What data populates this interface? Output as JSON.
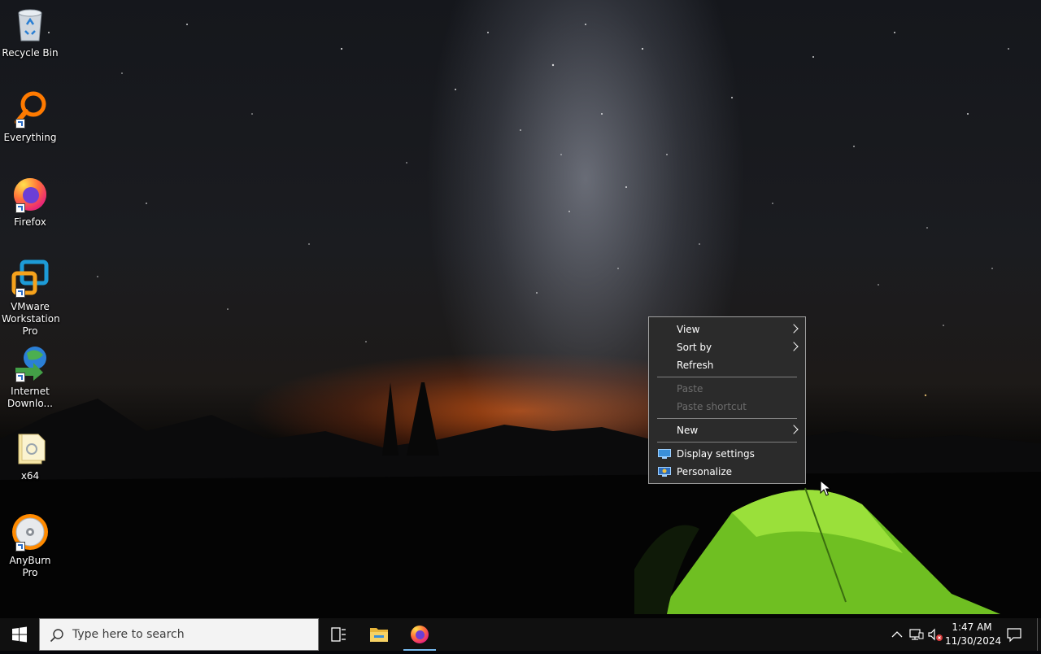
{
  "desktop_icons": [
    {
      "label": "Recycle Bin",
      "icon": "recycle-bin-icon"
    },
    {
      "label": "Everything",
      "icon": "everything-search-icon"
    },
    {
      "label": "Firefox",
      "icon": "firefox-icon"
    },
    {
      "label": "VMware Workstation Pro",
      "icon": "vmware-icon"
    },
    {
      "label": "Internet Downlo...",
      "icon": "internet-download-manager-icon"
    },
    {
      "label": "x64",
      "icon": "folder-icon"
    },
    {
      "label": "AnyBurn Pro",
      "icon": "anyburn-disc-icon"
    }
  ],
  "context_menu": {
    "view": "View",
    "sort_by": "Sort by",
    "refresh": "Refresh",
    "paste": "Paste",
    "paste_shortcut": "Paste shortcut",
    "new": "New",
    "display_settings": "Display settings",
    "personalize": "Personalize"
  },
  "taskbar": {
    "search_placeholder": "Type here to search",
    "time": "1:47 AM",
    "date": "11/30/2024",
    "pinned": [
      "task-view-icon",
      "file-explorer-icon",
      "firefox-icon"
    ],
    "active_app": "firefox"
  },
  "colors": {
    "taskbar_bg": "#101010",
    "menu_bg": "#2b2b2b",
    "accent": "#76b9ed"
  }
}
